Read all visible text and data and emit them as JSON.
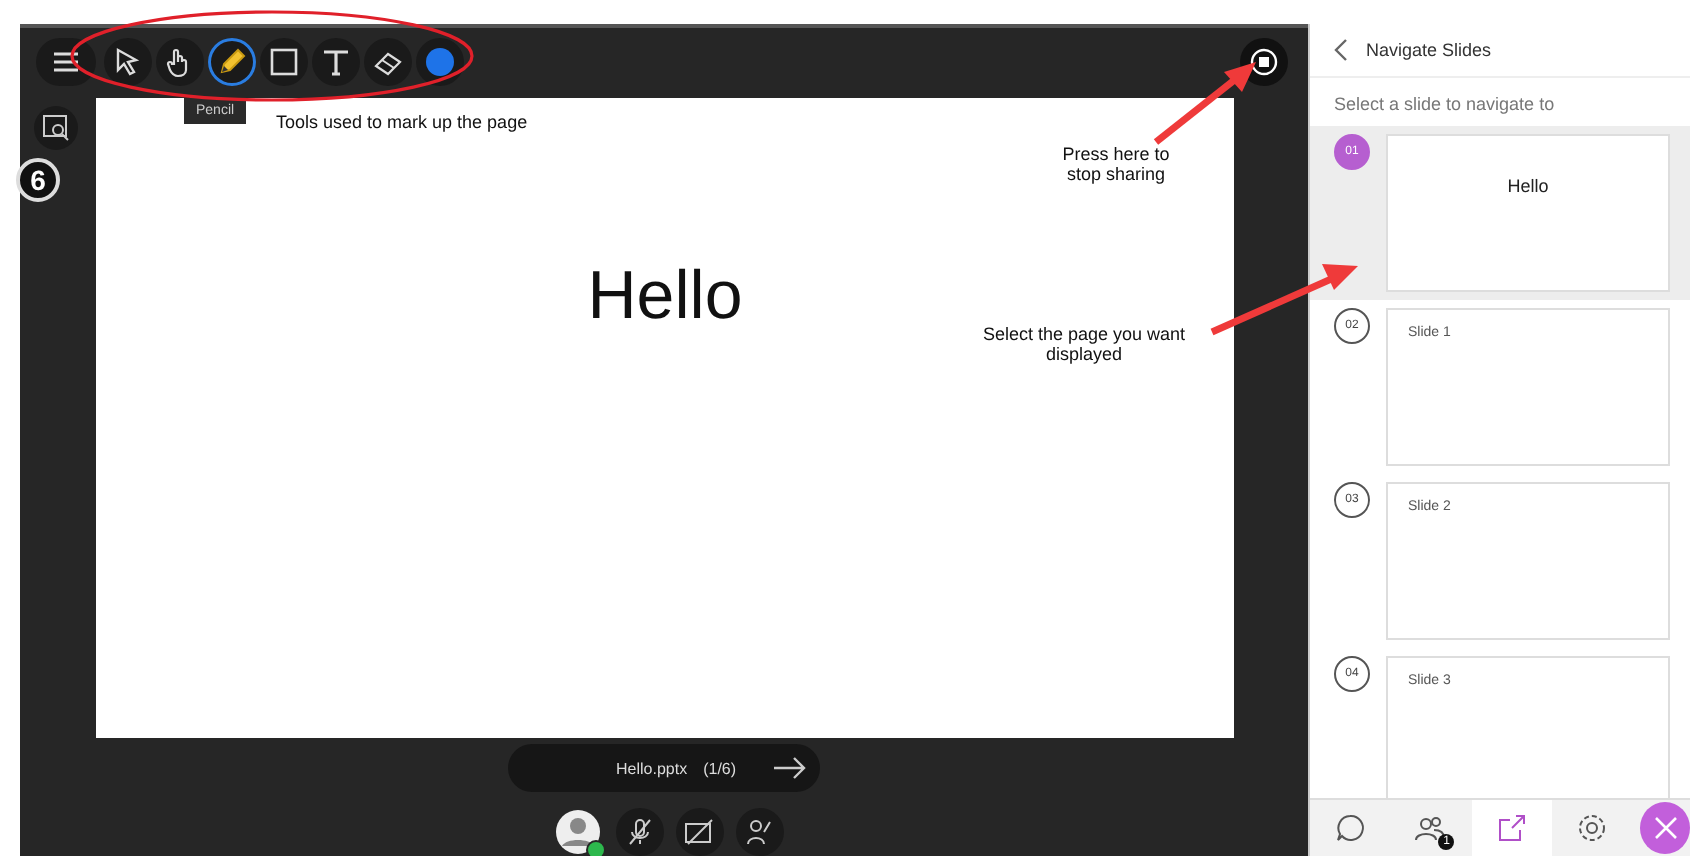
{
  "toolbar": {
    "tools": [
      {
        "kind": "pointer",
        "selected": false
      },
      {
        "kind": "hand",
        "selected": false
      },
      {
        "kind": "pencil",
        "selected": true
      },
      {
        "kind": "rectangle",
        "selected": false
      },
      {
        "kind": "text",
        "selected": false
      },
      {
        "kind": "eraser",
        "selected": false
      }
    ],
    "tooltip": "Pencil"
  },
  "step_badge": "6",
  "slide": {
    "title": "Hello"
  },
  "annotations": [
    "Tools used to mark up the page",
    "Press here to stop sharing",
    "Select the page you want displayed"
  ],
  "file_bar": {
    "name": "Hello.pptx",
    "position": "(1/6)"
  },
  "panel": {
    "title": "Navigate Slides",
    "subtitle": "Select a slide to navigate to",
    "slides": [
      {
        "number": "01",
        "title": "Hello",
        "kind": "title",
        "selected": true
      },
      {
        "number": "02",
        "title": "Slide 1",
        "kind": "content",
        "selected": false
      },
      {
        "number": "03",
        "title": "Slide 2",
        "kind": "content",
        "selected": false
      },
      {
        "number": "04",
        "title": "Slide 3",
        "kind": "content",
        "selected": false
      }
    ]
  },
  "bottom_tabs": [
    {
      "kind": "chat",
      "selected": false
    },
    {
      "kind": "attendees",
      "selected": false,
      "badge": "1"
    },
    {
      "kind": "share",
      "selected": true
    },
    {
      "kind": "settings",
      "selected": false
    }
  ]
}
